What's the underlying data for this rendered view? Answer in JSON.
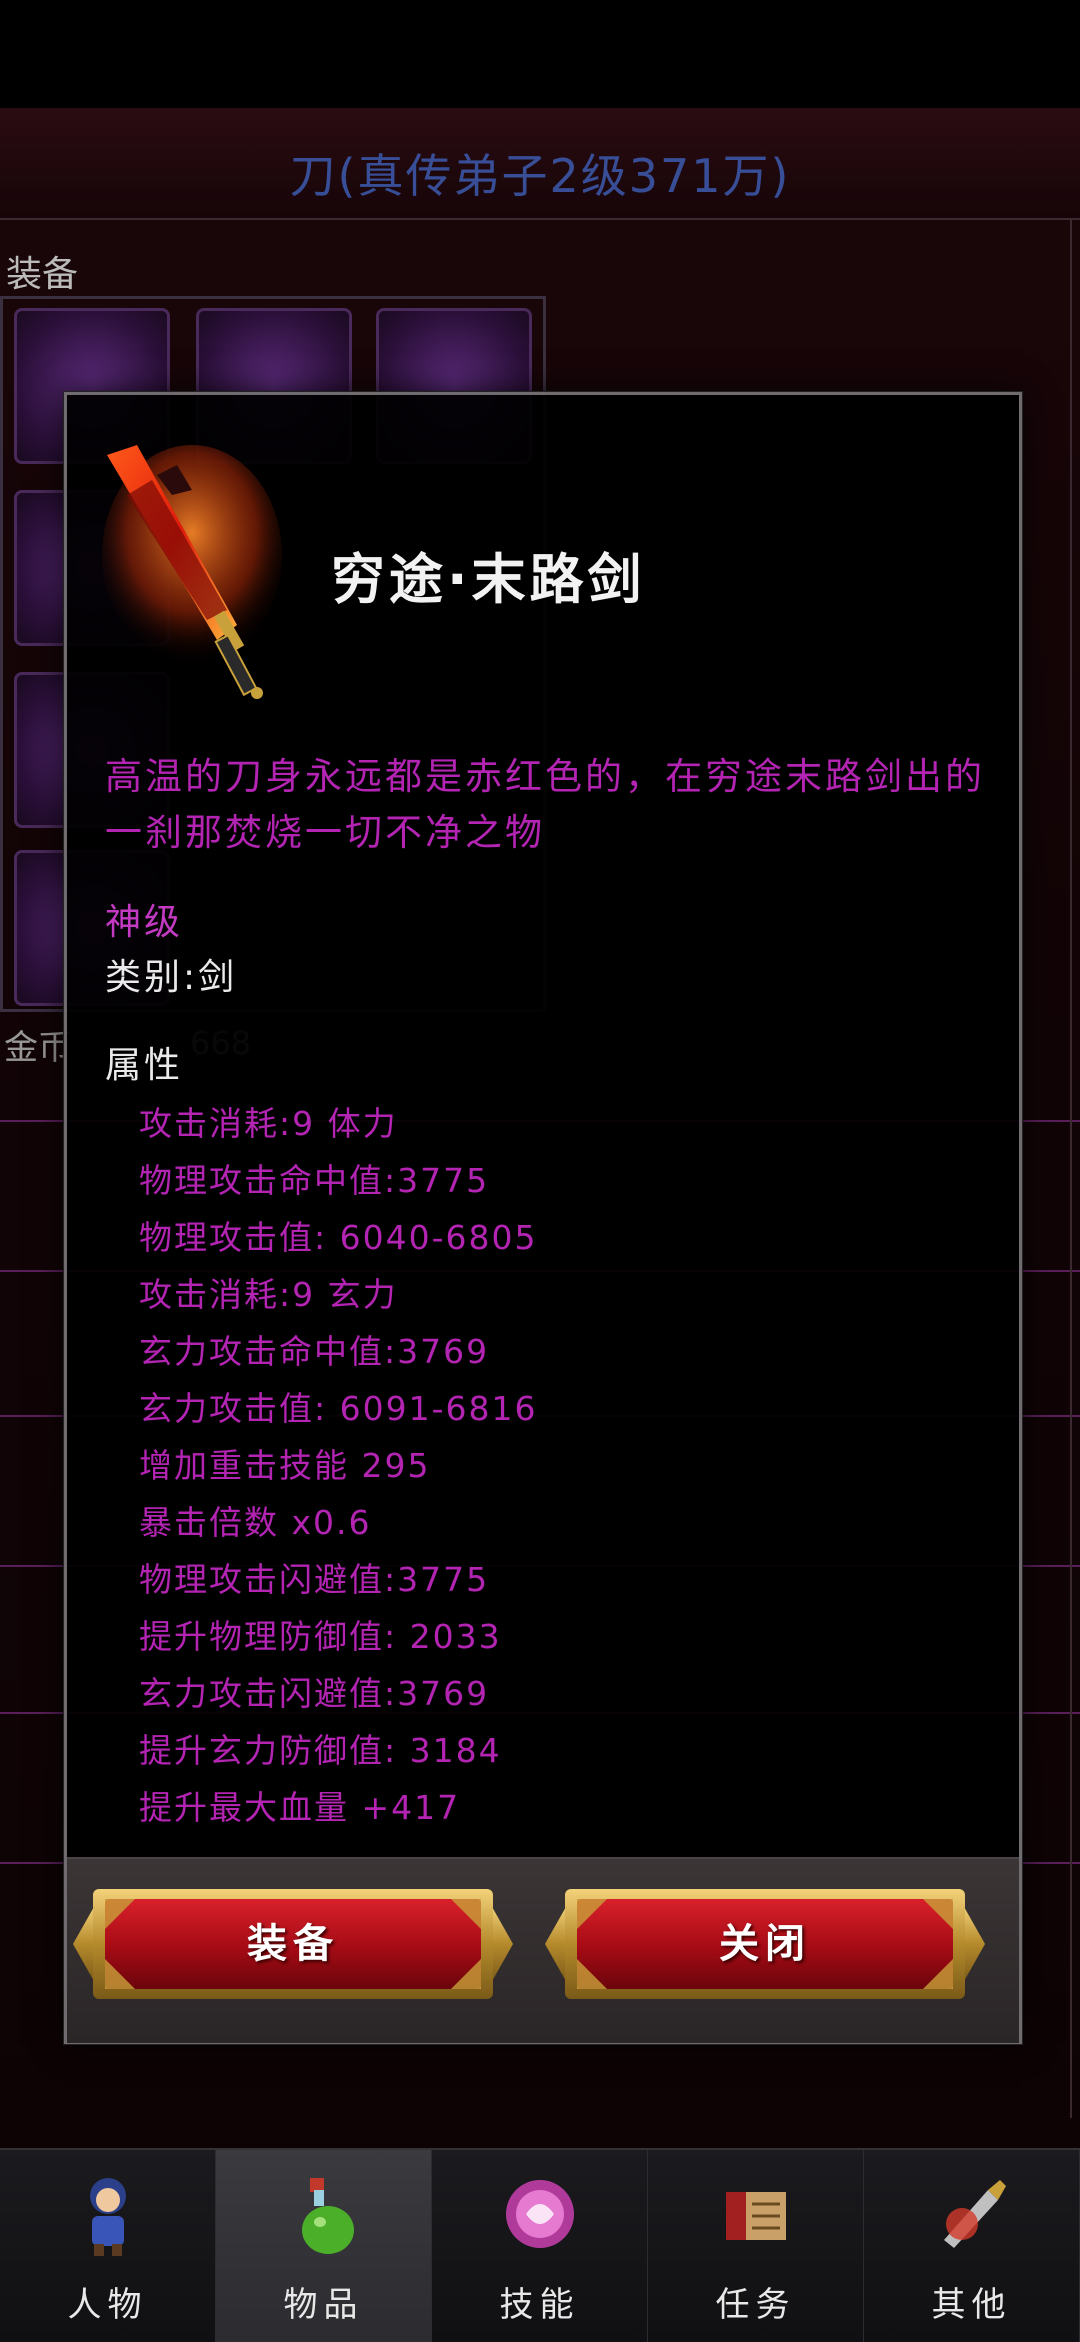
{
  "background": {
    "title": "刀(真传弟子2级371万)",
    "equip_label": "装备",
    "gold_label": "金币",
    "gold_value": "668"
  },
  "dialog": {
    "item_name": "穷途·末路剑",
    "description": "高温的刀身永远都是赤红色的，在穷途末路剑出的一刹那焚烧一切不净之物",
    "grade": "神级",
    "category": "类别:剑",
    "attr_heading": "属性",
    "attributes": [
      {
        "label": "攻击消耗:9 体力"
      },
      {
        "label": "物理攻击命中值:3775"
      },
      {
        "label": "物理攻击值:  6040-6805"
      },
      {
        "label": "攻击消耗:9 玄力"
      },
      {
        "label": "玄力攻击命中值:3769"
      },
      {
        "label": "玄力攻击值:  6091-6816"
      },
      {
        "label": "增加重击技能 295"
      },
      {
        "label": "暴击倍数 x0.6"
      },
      {
        "label": "物理攻击闪避值:3775"
      },
      {
        "label": "提升物理防御值:  2033"
      },
      {
        "label": "玄力攻击闪避值:3769"
      },
      {
        "label": "提升玄力防御值:  3184"
      },
      {
        "label": "提升最大血量 +417"
      }
    ],
    "buttons": {
      "equip": "装备",
      "close": "关闭"
    }
  },
  "nav": {
    "tabs": [
      {
        "label": "人物",
        "icon": "character-icon"
      },
      {
        "label": "物品",
        "icon": "potion-icon"
      },
      {
        "label": "技能",
        "icon": "skill-icon"
      },
      {
        "label": "任务",
        "icon": "quest-icon"
      },
      {
        "label": "其他",
        "icon": "other-icon"
      }
    ],
    "active_index": 1
  },
  "colors": {
    "attribute_text": "#b324b3",
    "button_red": "#b0101a",
    "button_gold": "#c9a13a"
  }
}
